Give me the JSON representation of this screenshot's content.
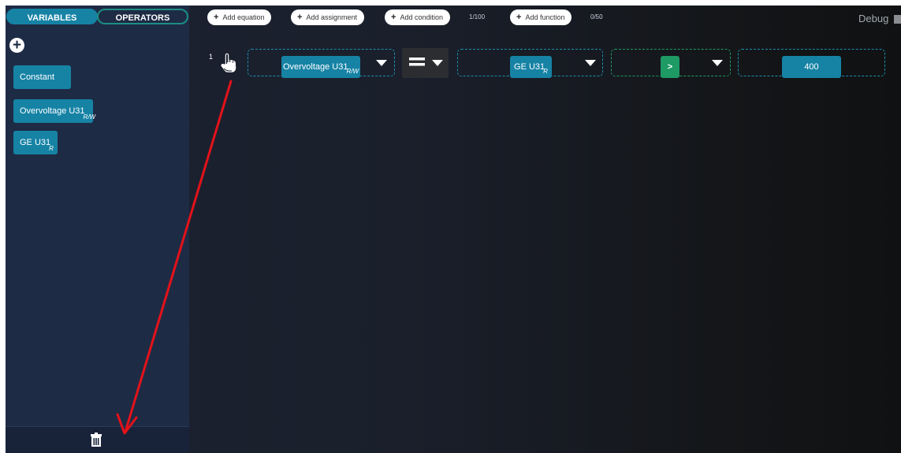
{
  "sidebar": {
    "tabs": [
      {
        "label": "VARIABLES"
      },
      {
        "label": "OPERATORS"
      }
    ],
    "add_icon": "plus-circle-icon",
    "variables": [
      {
        "label": "Constant",
        "sub": ""
      },
      {
        "label": "Overvoltage U31",
        "sub": "R/W"
      },
      {
        "label": "GE U31",
        "sub": "R"
      }
    ],
    "trash_icon": "trash-icon"
  },
  "toolbar": {
    "add_equation": "Add equation",
    "add_assignment": "Add assignment",
    "add_condition": "Add condition",
    "condition_counter": "1/100",
    "add_function": "Add function",
    "function_counter": "0/50",
    "debug_label": "Debug"
  },
  "equation": {
    "row_number": "1",
    "left_var": {
      "label": "Overvoltage U31",
      "sub": "R/W"
    },
    "operator_icon": "equals-icon",
    "right_var": {
      "label": "GE U31",
      "sub": "R"
    },
    "comparator": ">",
    "value": "400"
  },
  "colors": {
    "accent": "#1683a5",
    "green": "#1e9a64",
    "sidebar": "#1e2b45",
    "annotation_arrow": "#e3121a"
  }
}
